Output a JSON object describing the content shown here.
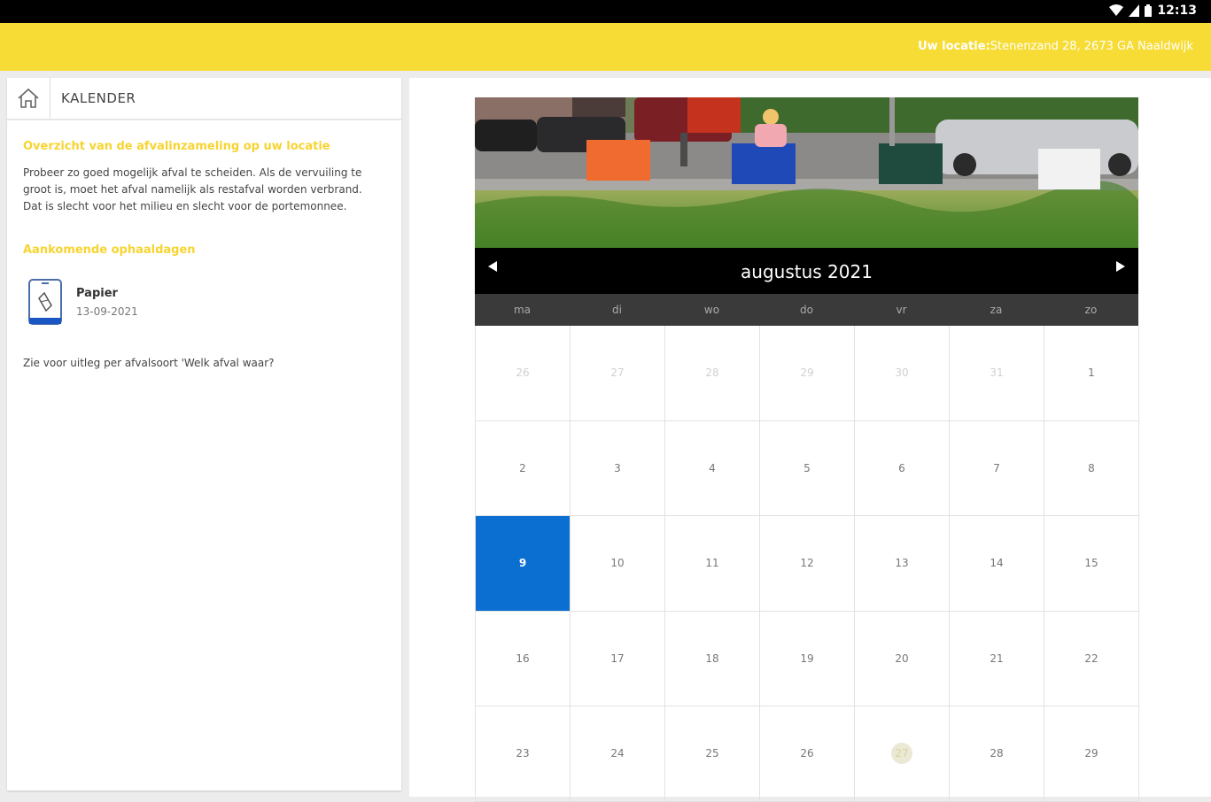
{
  "status": {
    "time": "12:13"
  },
  "header": {
    "location_label": "Uw locatie:",
    "location_value": "Stenenzand 28, 2673 GA Naaldwijk"
  },
  "breadcrumb": {
    "home_icon": "home-icon",
    "label": "KALENDER"
  },
  "overview": {
    "title": "Overzicht van de afvalinzameling op uw locatie",
    "intro": "Probeer zo goed mogelijk afval te scheiden. Als de vervuiling te groot is, moet het afval namelijk als restafval worden verbrand. Dat is slecht voor het milieu en slecht voor de portemonnee.",
    "upcoming_title": "Aankomende ophaaldagen",
    "pickups": [
      {
        "icon": "paper-bin-icon",
        "name": "Papier",
        "date": "13-09-2021"
      }
    ],
    "hint": "Zie voor uitleg per afvalsoort 'Welk afval waar?"
  },
  "calendar": {
    "month_title": "augustus 2021",
    "prev_icon": "triangle-left-icon",
    "next_icon": "triangle-right-icon",
    "weekdays": [
      "ma",
      "di",
      "wo",
      "do",
      "vr",
      "za",
      "zo"
    ],
    "days": [
      {
        "d": "26",
        "muted": true
      },
      {
        "d": "27",
        "muted": true
      },
      {
        "d": "28",
        "muted": true
      },
      {
        "d": "29",
        "muted": true
      },
      {
        "d": "30",
        "muted": true
      },
      {
        "d": "31",
        "muted": true
      },
      {
        "d": "1"
      },
      {
        "d": "2"
      },
      {
        "d": "3"
      },
      {
        "d": "4"
      },
      {
        "d": "5"
      },
      {
        "d": "6"
      },
      {
        "d": "7"
      },
      {
        "d": "8"
      },
      {
        "d": "9",
        "selected": true
      },
      {
        "d": "10"
      },
      {
        "d": "11"
      },
      {
        "d": "12"
      },
      {
        "d": "13"
      },
      {
        "d": "14"
      },
      {
        "d": "15"
      },
      {
        "d": "16"
      },
      {
        "d": "17"
      },
      {
        "d": "18"
      },
      {
        "d": "19"
      },
      {
        "d": "20"
      },
      {
        "d": "21"
      },
      {
        "d": "22"
      },
      {
        "d": "23"
      },
      {
        "d": "24"
      },
      {
        "d": "25"
      },
      {
        "d": "26"
      },
      {
        "d": "27",
        "today": true
      },
      {
        "d": "28"
      },
      {
        "d": "29"
      }
    ]
  },
  "colors": {
    "yellow": "#f7dc36",
    "selected_blue": "#0b6fd1"
  }
}
